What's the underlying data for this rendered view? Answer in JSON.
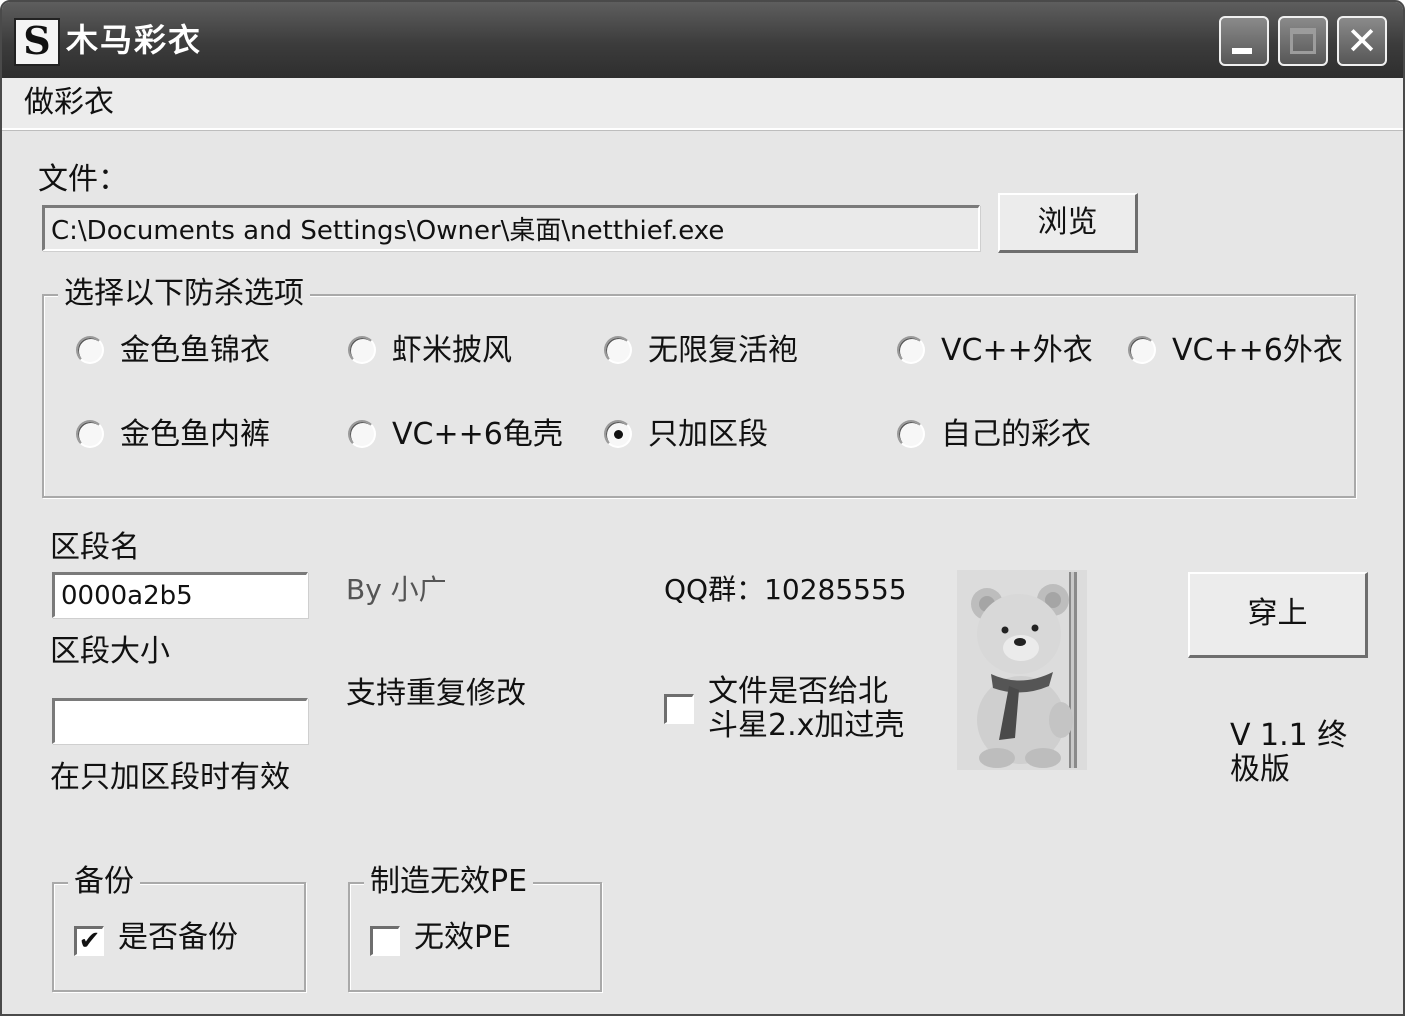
{
  "window": {
    "title": "木马彩衣",
    "app_icon": "S",
    "close_glyph": "✕"
  },
  "menu": {
    "items": [
      "做彩衣"
    ]
  },
  "file": {
    "label": "文件：",
    "path": "C:\\Documents and Settings\\Owner\\桌面\\netthief.exe",
    "browse_label": "浏览"
  },
  "options": {
    "legend": "选择以下防杀选项",
    "radios": [
      {
        "label": "金色鱼锦衣",
        "selected": false
      },
      {
        "label": "虾米披风",
        "selected": false
      },
      {
        "label": "无限复活袍",
        "selected": false
      },
      {
        "label": "VC++外衣",
        "selected": false
      },
      {
        "label": "VC++6外衣",
        "selected": false
      },
      {
        "label": "金色鱼内裤",
        "selected": false
      },
      {
        "label": "VC++6龟壳",
        "selected": false
      },
      {
        "label": "只加区段",
        "selected": true
      },
      {
        "label": "自己的彩衣",
        "selected": false
      }
    ]
  },
  "section": {
    "name_label": "区段名",
    "name_value": "0000a2b5",
    "size_label": "区段大小",
    "size_value": "",
    "note": "在只加区段时有效"
  },
  "info": {
    "author": "By 小广",
    "repeat": "支持重复修改",
    "qq": "QQ群：10285555",
    "packed_label_line1": "文件是否给北",
    "packed_label_line2": "斗星2.x加过壳",
    "packed_checked": false
  },
  "apply_label": "穿上",
  "version_line1": "V 1.1 终",
  "version_line2": "极版",
  "backup": {
    "legend": "备份",
    "label": "是否备份",
    "checked": true
  },
  "invalid_pe": {
    "legend": "制造无效PE",
    "label": "无效PE",
    "checked": false
  },
  "icons": {
    "check_glyph": "✔",
    "picture": "teddy-bear-icon"
  }
}
